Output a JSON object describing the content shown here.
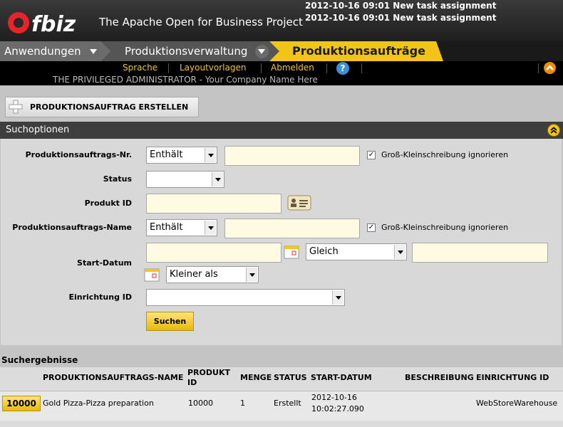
{
  "header": {
    "logo_text": "ofbiz",
    "tagline": "The Apache Open for Business Project",
    "notifications": [
      "2012-10-16 09:01 New task assignment",
      "2012-10-16 09:01 New task assignment"
    ]
  },
  "tabs": [
    {
      "label": "Anwendungen",
      "has_dropdown": true
    },
    {
      "label": "Produktionsverwaltung",
      "has_dropdown": true
    },
    {
      "label": "Produktionsaufträge",
      "active": true
    }
  ],
  "menu": {
    "links": [
      "Sprache",
      "Layoutvorlagen",
      "Abmelden"
    ],
    "help_icon": "help-icon",
    "user_line": "THE PRIVILEGED ADMINISTRATOR - Your Company Name Here"
  },
  "actions": {
    "create_label": "PRODUKTIONSAUFTRAG ERSTELLEN"
  },
  "search": {
    "title": "Suchoptionen",
    "order_no_label": "Produktionsauftrags-Nr.",
    "order_no_op": "Enthält",
    "order_no_value": "",
    "ignore_case_label": "Groß-Kleinschreibung ignorieren",
    "status_label": "Status",
    "status_value": "",
    "product_id_label": "Produkt ID",
    "product_id_value": "",
    "order_name_label": "Produktionsauftrags-Name",
    "order_name_op": "Enthält",
    "order_name_value": "",
    "start_date_label": "Start-Datum",
    "start_op1": "Gleich",
    "start_op2": "Kleiner als",
    "facility_label": "Einrichtung ID",
    "facility_value": "",
    "submit_label": "Suchen"
  },
  "results": {
    "title": "Suchergebnisse",
    "columns": [
      "PRODUKTIONSAUFTRAGS-NAME",
      "PRODUKT ID",
      "MENGE",
      "STATUS",
      "START-DATUM",
      "BESCHREIBUNG",
      "EINRICHTUNG ID"
    ],
    "rows": [
      {
        "id": "10000",
        "name": "Gold Pizza-Pizza preparation",
        "product_id": "10000",
        "quantity": "1",
        "status": "Erstellt",
        "start_date_1": "2012-10-16",
        "start_date_2": "10:02:27.090",
        "description": "",
        "facility": "WebStoreWarehouse"
      }
    ]
  },
  "colors": {
    "accent": "#f5c518",
    "input_bg": "#fffbe2",
    "header_bg": "#2a2a2a"
  }
}
